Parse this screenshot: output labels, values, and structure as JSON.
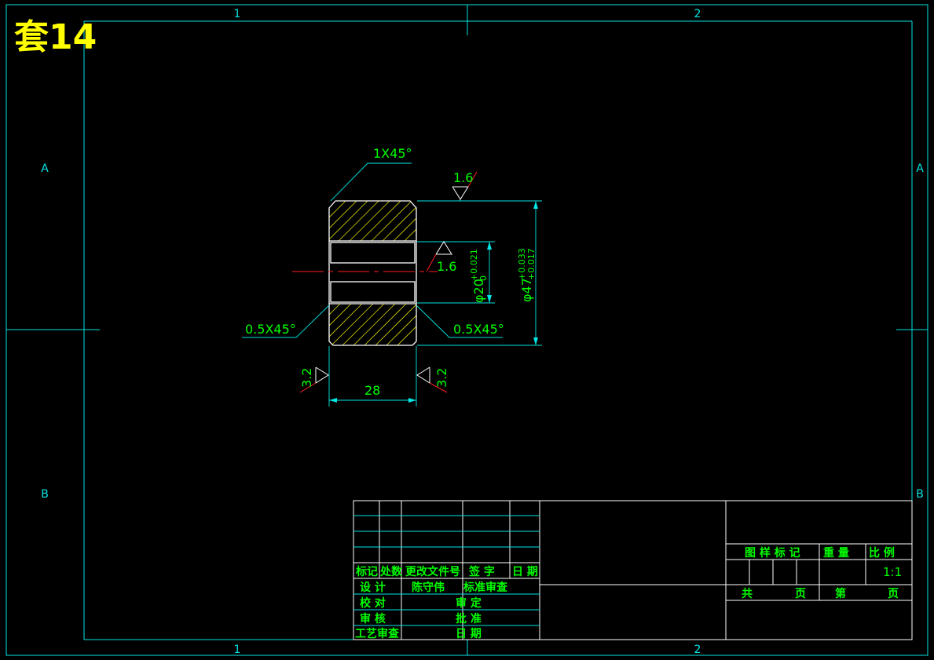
{
  "title": "套14",
  "zone_labels": {
    "columns": [
      "1",
      "2"
    ],
    "rows": [
      "A",
      "B"
    ]
  },
  "drawing": {
    "chamfer_top_left": "1X45°",
    "chamfer_bottom_left": "0.5X45°",
    "chamfer_bottom_right": "0.5X45°",
    "roughness_outer": "1.6",
    "roughness_bore": "1.6",
    "roughness_left_face": "3.2",
    "roughness_right_face": "3.2",
    "length_dim": "28",
    "bore_dim": "φ20",
    "bore_tol_upper": "+0.021",
    "bore_tol_lower": "0",
    "outer_dim": "φ47",
    "outer_tol_upper": "+0.033",
    "outer_tol_lower": "+0.017"
  },
  "title_block": {
    "rev_headers": [
      "标记",
      "处数",
      "更改文件号",
      "签  字",
      "日  期"
    ],
    "row_design": "设  计",
    "designer_name": "陈守伟",
    "row_std_review": "标准审查",
    "row_proof": "校  对",
    "row_approve_review": "审  定",
    "row_audit": "审  核",
    "row_ratify": "批  准",
    "row_process": "工艺审查",
    "row_date": "日  期",
    "drawing_mark_label": "图 样 标 记",
    "weight_label": "重  量",
    "scale_label": "比  例",
    "scale_value": "1:1",
    "total_pages_prefix": "共",
    "total_pages_suffix": "页",
    "page_no_prefix": "第",
    "page_no_suffix": "页"
  },
  "colors": {
    "background": "#000000",
    "frame": "#00e5e5",
    "outline": "#ffffff",
    "dimension_text": "#00ff00",
    "hatch": "#ffff00",
    "center_line": "#ff0000",
    "title_text": "#ffff00",
    "roughness_leader": "#ff2020"
  }
}
